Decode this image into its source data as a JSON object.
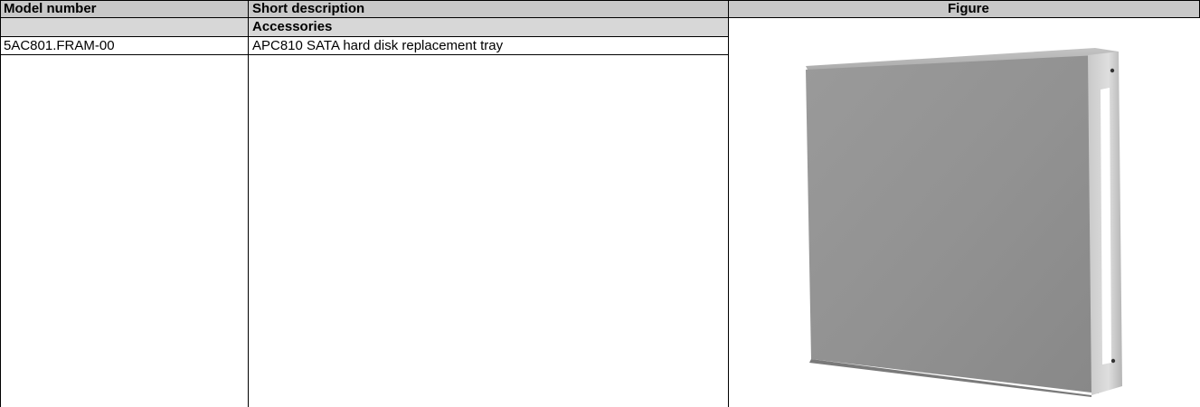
{
  "table": {
    "columns": [
      "Model number",
      "Short description",
      "Figure"
    ],
    "group_heading": "Accessories",
    "rows": [
      {
        "model_number": "5AC801.FRAM-00",
        "short_description": "APC810 SATA hard disk replacement tray",
        "figure_icon": "hard-disk-tray-image"
      }
    ]
  },
  "colors": {
    "header_background": "#c8c8c8",
    "group_background": "#d7d7d7",
    "tray_face": "#939393",
    "tray_edge": "#d8d8d8"
  }
}
